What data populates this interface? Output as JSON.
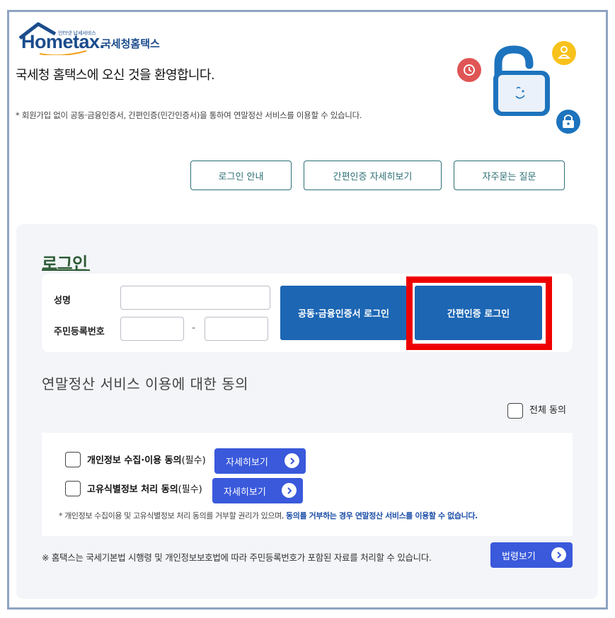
{
  "header": {
    "logo_sub": "인터넷 납세서비스",
    "logo_brand": "Hometax.",
    "logo_kr": "국세청홈택스",
    "welcome": "국세청 홈택스에 오신 것을 환영합니다.",
    "notice": "* 회원가입 없이 공동·금융인증서, 간편인증(민간인증서)을 통하여 연말정산 서비스를 이용할 수 있습니다."
  },
  "top_buttons": {
    "login_guide": "로그인 안내",
    "simple_auth_detail": "간편인증 자세히보기",
    "faq": "자주묻는 질문"
  },
  "login": {
    "title": "로그인",
    "name_label": "성명",
    "rrn_label": "주민등록번호",
    "rrn_dash": "-",
    "cert_login": "공동·금융인증서 로그인",
    "simple_login": "간편인증 로그인"
  },
  "consent": {
    "title": "연말정산 서비스 이용에 대한 동의",
    "all_agree": "전체 동의",
    "item1_bold": "개인정보 수집·이용 동의",
    "item1_req": "(필수)",
    "item2_bold": "고유식별정보 처리 동의",
    "item2_req": "(필수)",
    "detail_label": "자세히보기",
    "fine_print": "* 개인정보 수집이용 및 고유식별정보 처리 동의를 거부할 권리가 있으며, ",
    "fine_print_emphasis": "동의를 거부하는 경우 연말정산 서비스를 이용할 수 없습니다.",
    "law_notice": "※ 홈택스는 국세기본법 시행령 및 개인정보보호법에 따라 주민등록번호가 포함된 자료를 처리할 수 있습니다.",
    "law_button": "법령보기"
  },
  "colors": {
    "brand_blue": "#1b4c8c",
    "login_button": "#1c66b4",
    "detail_button": "#3a59db",
    "highlight_red": "#ee0000"
  }
}
